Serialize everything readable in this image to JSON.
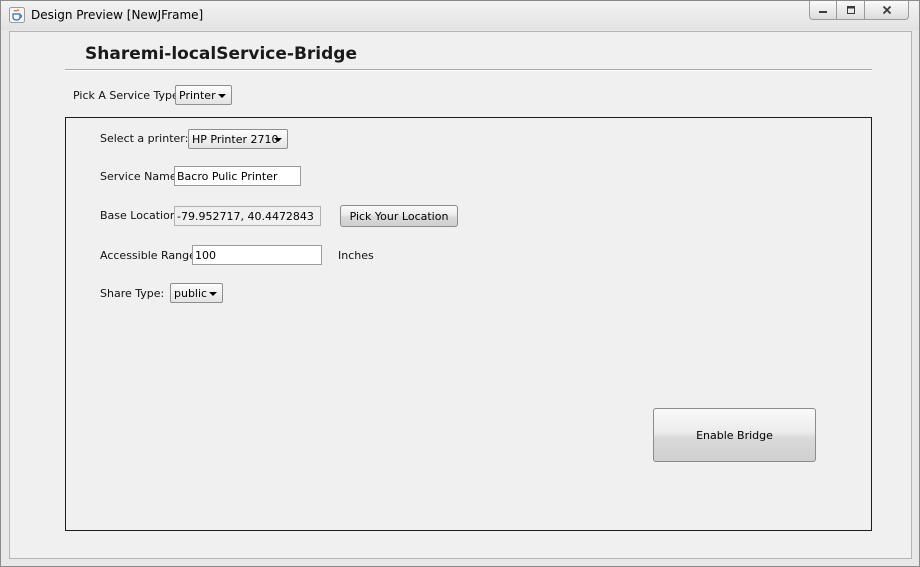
{
  "window": {
    "title": "Design Preview [NewJFrame]",
    "icon": "java-cup-icon"
  },
  "app": {
    "heading": "Sharemi-localService-Bridge"
  },
  "service_type": {
    "label": "Pick A Service Type:",
    "selected": "Printer"
  },
  "form": {
    "printer_label": "Select a printer:",
    "printer_selected": "HP Printer 2710",
    "service_name_label": "Service Name:",
    "service_name_value": "Bacro Pulic Printer",
    "base_location_label": "Base Location:",
    "base_location_value": "-79.952717,  40.4472843",
    "pick_location_button": "Pick Your Location",
    "range_label": "Accessible Range:",
    "range_value": "100",
    "range_unit": "Inches",
    "share_type_label": "Share Type:",
    "share_type_selected": "public"
  },
  "actions": {
    "enable_bridge": "Enable Bridge"
  }
}
